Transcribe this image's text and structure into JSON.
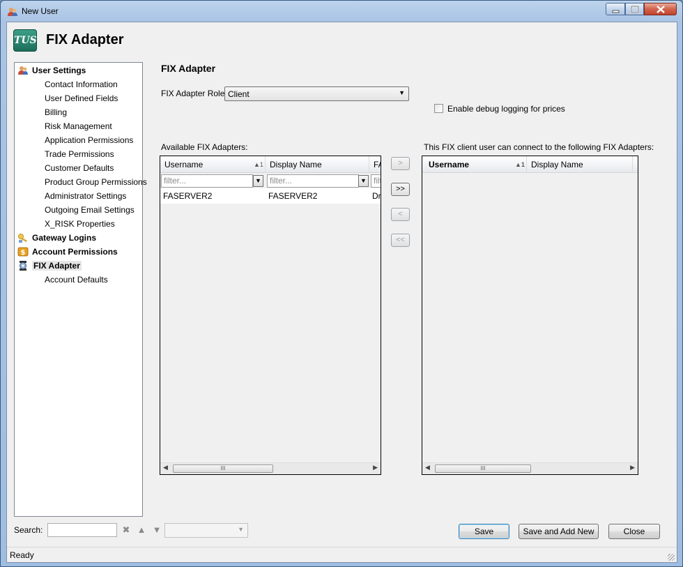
{
  "window": {
    "title": "New User",
    "minimize_glyph": "—",
    "maximize_glyph": "☐",
    "close_glyph": "✕"
  },
  "header": {
    "logo_text": "TUS",
    "title": "FIX Adapter"
  },
  "nav": {
    "groups": [
      {
        "label": "User Settings",
        "icon": "users-icon",
        "items": [
          "Contact Information",
          "User Defined Fields",
          "Billing",
          "Risk Management",
          "Application Permissions",
          "Trade Permissions",
          "Customer Defaults",
          "Product Group Permissions",
          "Administrator Settings",
          "Outgoing Email Settings",
          "X_RISK Properties"
        ]
      },
      {
        "label": "Gateway Logins",
        "icon": "key-icon",
        "items": []
      },
      {
        "label": "Account Permissions",
        "icon": "coins-icon",
        "items": []
      },
      {
        "label": "FIX Adapter",
        "icon": "plug-icon",
        "items": [
          "Account Defaults"
        ],
        "selected": true
      }
    ]
  },
  "content": {
    "title": "FIX Adapter",
    "role_label": "FIX Adapter Role:",
    "role_value": "Client",
    "debug_label": "Enable debug logging for prices",
    "debug_checked": false,
    "available_label": "Available FIX Adapters:",
    "connected_label": "This FIX client user can connect to the following FIX Adapters:"
  },
  "available_grid": {
    "columns": [
      "Username",
      "Display Name",
      "FA"
    ],
    "sort_indicator": "▲1",
    "filter_placeholder": "filter...",
    "filter_partial": "filt",
    "rows": [
      {
        "username": "FASERVER2",
        "display_name": "FASERVER2",
        "third": "Dr"
      }
    ],
    "scroll_grip": "III"
  },
  "connected_grid": {
    "columns": [
      "Username",
      "Display Name"
    ],
    "sort_indicator": "▲1",
    "rows": [],
    "scroll_grip": "III"
  },
  "move_buttons": {
    "add_one": ">",
    "add_all": ">>",
    "remove_one": "<",
    "remove_all": "<<"
  },
  "footer": {
    "search_label": "Search:",
    "search_value": "",
    "save": "Save",
    "save_and_add_new": "Save and Add New",
    "close": "Close"
  },
  "status": {
    "text": "Ready"
  },
  "colors": {
    "title_gradient": "#a9c4e4",
    "client_bg": "#f0f0f0",
    "close_button": "#c0442d"
  }
}
